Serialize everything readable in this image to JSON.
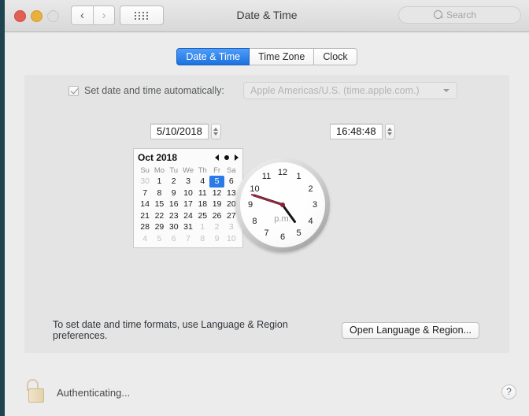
{
  "window": {
    "title": "Date & Time",
    "traffic_lights": [
      "close",
      "minimize",
      "zoom"
    ],
    "nav_back_icon": "chevron-left-icon",
    "nav_forward_icon": "chevron-right-icon",
    "grid_icon": "show-all-grid-icon"
  },
  "search": {
    "placeholder": "Search",
    "icon": "search-icon"
  },
  "tabs": [
    {
      "label": "Date & Time",
      "active": true
    },
    {
      "label": "Time Zone",
      "active": false
    },
    {
      "label": "Clock",
      "active": false
    }
  ],
  "auto_time": {
    "checkbox_checked": true,
    "label": "Set date and time automatically:",
    "server_value": "Apple Americas/U.S. (time.apple.com.)",
    "disabled": true
  },
  "date_field": {
    "value": "5/10/2018",
    "stepper_icon": "stepper-updown-icon"
  },
  "time_field": {
    "value": "16:48:48",
    "stepper_icon": "stepper-updown-icon"
  },
  "calendar": {
    "month_label": "Oct 2018",
    "prev_icon": "triangle-left-icon",
    "today_icon": "dot-icon",
    "next_icon": "triangle-right-icon",
    "day_headers": [
      "Su",
      "Mo",
      "Tu",
      "We",
      "Th",
      "Fr",
      "Sa"
    ],
    "selected_day": 5,
    "weeks": [
      [
        {
          "d": "30",
          "dim": true
        },
        {
          "d": "1"
        },
        {
          "d": "2"
        },
        {
          "d": "3"
        },
        {
          "d": "4"
        },
        {
          "d": "5",
          "sel": true
        },
        {
          "d": "6"
        }
      ],
      [
        {
          "d": "7"
        },
        {
          "d": "8"
        },
        {
          "d": "9"
        },
        {
          "d": "10"
        },
        {
          "d": "11"
        },
        {
          "d": "12"
        },
        {
          "d": "13"
        }
      ],
      [
        {
          "d": "14"
        },
        {
          "d": "15"
        },
        {
          "d": "16"
        },
        {
          "d": "17"
        },
        {
          "d": "18"
        },
        {
          "d": "19"
        },
        {
          "d": "20"
        }
      ],
      [
        {
          "d": "21"
        },
        {
          "d": "22"
        },
        {
          "d": "23"
        },
        {
          "d": "24"
        },
        {
          "d": "25"
        },
        {
          "d": "26"
        },
        {
          "d": "27"
        }
      ],
      [
        {
          "d": "28"
        },
        {
          "d": "29"
        },
        {
          "d": "30"
        },
        {
          "d": "31"
        },
        {
          "d": "1",
          "dim": true
        },
        {
          "d": "2",
          "dim": true
        },
        {
          "d": "3",
          "dim": true
        }
      ],
      [
        {
          "d": "4",
          "dim": true
        },
        {
          "d": "5",
          "dim": true
        },
        {
          "d": "6",
          "dim": true
        },
        {
          "d": "7",
          "dim": true
        },
        {
          "d": "8",
          "dim": true
        },
        {
          "d": "9",
          "dim": true
        },
        {
          "d": "10",
          "dim": true
        }
      ]
    ]
  },
  "clock": {
    "hour_numbers": [
      "12",
      "1",
      "2",
      "3",
      "4",
      "5",
      "6",
      "7",
      "8",
      "9",
      "10",
      "11"
    ],
    "meridiem_label": "p.m.",
    "hour_angle": 144,
    "minute_angle": 288,
    "second_angle": 288,
    "second_hand_color": "#a8233c"
  },
  "note": {
    "text": "To set date and time formats, use Language & Region preferences.",
    "button_label": "Open Language & Region..."
  },
  "footer": {
    "lock_icon": "unlocked-padlock-icon",
    "status_text": "Authenticating...",
    "help_label": "?"
  }
}
